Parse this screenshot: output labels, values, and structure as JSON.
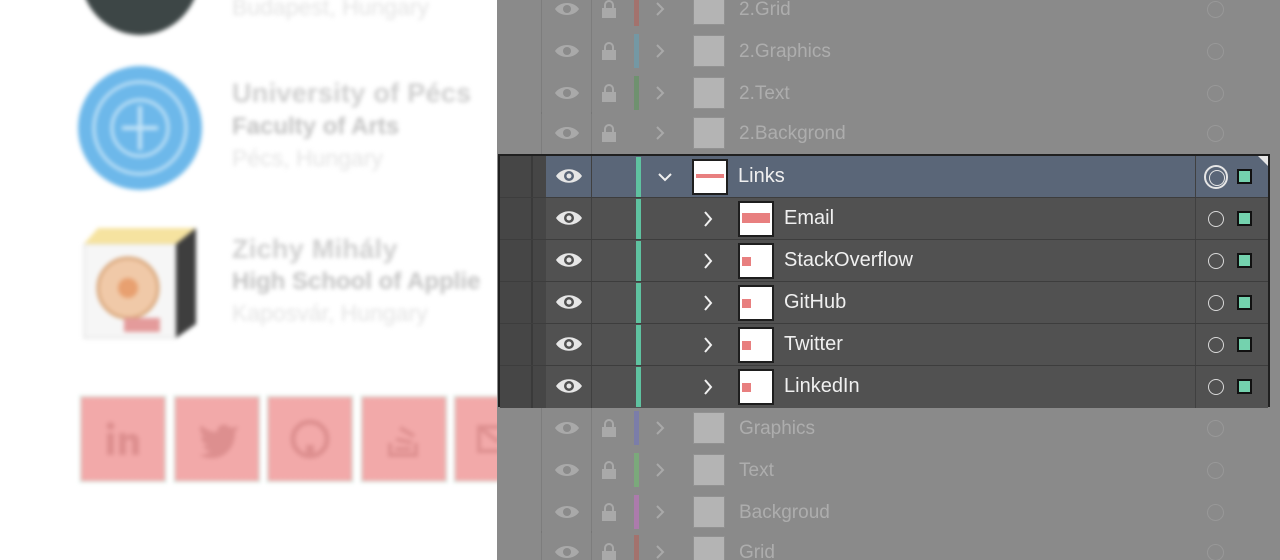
{
  "artboard": {
    "entries": [
      {
        "name": "",
        "faculty": "",
        "location": "Budapest, Hungary"
      },
      {
        "name": "University of Pécs",
        "faculty": "Faculty of Arts",
        "location": "Pécs, Hungary"
      },
      {
        "name": "Zichy Mihály",
        "faculty": "High School of Applie",
        "location": "Kaposvár, Hungary"
      }
    ],
    "social_icons": [
      "linkedin-icon",
      "twitter-icon",
      "github-icon",
      "stackoverflow-icon",
      "email-icon"
    ]
  },
  "layers": {
    "above": [
      {
        "name": "2.Grid",
        "color": "#c2574a"
      },
      {
        "name": "2.Graphics",
        "color": "#5aa9c4"
      },
      {
        "name": "2.Text",
        "color": "#4f9a4f"
      },
      {
        "name": "2.Backgrond",
        "color": "#8a8a8a"
      }
    ],
    "group": {
      "name": "Links",
      "children": [
        "Email",
        "StackOverflow",
        "GitHub",
        "Twitter",
        "LinkedIn"
      ]
    },
    "below": [
      {
        "name": "Graphics",
        "color": "#6a6fd0"
      },
      {
        "name": "Text",
        "color": "#6bcf6b"
      },
      {
        "name": "Backgroud",
        "color": "#d66bd6"
      },
      {
        "name": "Grid",
        "color": "#c2574a"
      }
    ],
    "colors": {
      "layer_accent": "#5fc2a0",
      "selection_square": "#74d2ae",
      "header_row": "#5a6678"
    }
  }
}
